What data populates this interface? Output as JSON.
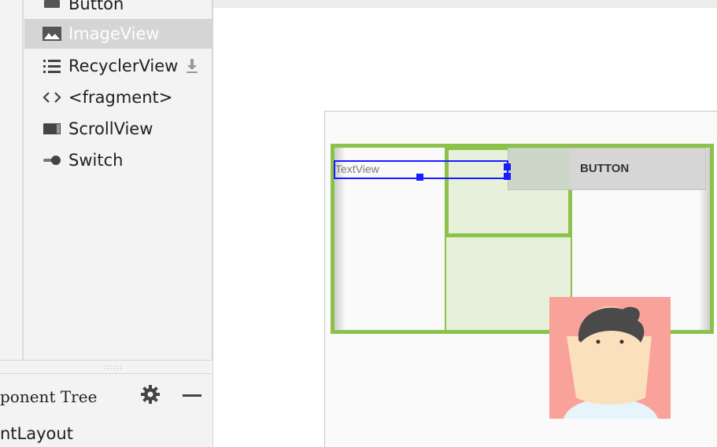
{
  "palette": {
    "items": [
      {
        "label": "Button",
        "icon": "button-icon",
        "selected": false
      },
      {
        "label": "ImageView",
        "icon": "image-icon",
        "selected": true
      },
      {
        "label": "RecyclerView",
        "icon": "list-icon",
        "selected": false
      },
      {
        "label": "<fragment>",
        "icon": "code-icon",
        "selected": false
      },
      {
        "label": "ScrollView",
        "icon": "scrollview-icon",
        "selected": false
      },
      {
        "label": "Switch",
        "icon": "switch-icon",
        "selected": false
      }
    ],
    "grip": "::::::"
  },
  "component_tree": {
    "title": "ponent Tree",
    "root_item": "ntLayout"
  },
  "canvas": {
    "textview_label": "TextView",
    "button_label": "BUTTON"
  },
  "colors": {
    "layout_outline": "#8bc34a",
    "selection": "#1a1aff",
    "imageview_background": "#f8a29a"
  }
}
